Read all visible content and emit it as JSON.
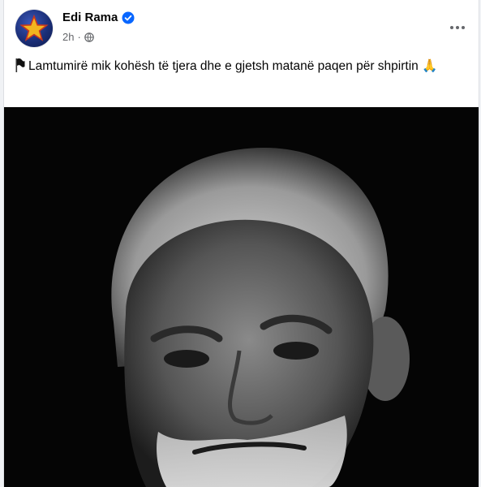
{
  "post": {
    "author": "Edi Rama",
    "time": "2h",
    "separator": "·",
    "caption_text": "Lamtumirë mik kohësh të tjera dhe e gjetsh matanë paqen për shpirtin",
    "caption_emoji": "🙏",
    "icons": {
      "avatar": "star-avatar",
      "verified": "verified-badge-icon",
      "privacy": "globe-icon",
      "more": "more-options-icon",
      "flag": "black-flag-icon"
    }
  },
  "colors": {
    "verified_blue": "#0866ff",
    "text_primary": "#050505",
    "text_secondary": "#65676b"
  }
}
